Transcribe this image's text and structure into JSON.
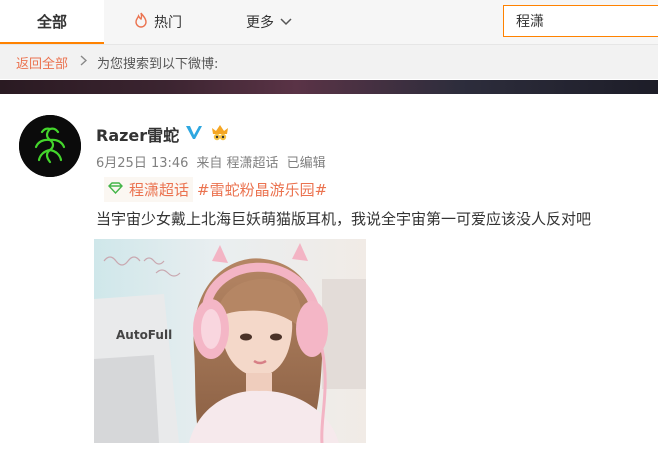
{
  "nav": {
    "tab_all": "全部",
    "tab_hot": "热门",
    "tab_more": "更多",
    "search_value": "程潇"
  },
  "breadcrumb": {
    "back_label": "返回全部",
    "hint": "为您搜索到以下微博:"
  },
  "post": {
    "author": "Razer雷蛇",
    "date": "6月25日 13:46",
    "source": "来自 程潇超话",
    "edited": "已编辑",
    "topic_super": "程潇超话",
    "topic_tag": "#雷蛇粉晶游乐园#",
    "text": "当宇宙少女戴上北海巨妖萌猫版耳机，我说全宇宙第一可爱应该没人反对吧",
    "photo_logo_text": "AutoFull"
  },
  "colors": {
    "accent": "#ff8200",
    "link": "#eb7350",
    "verified_blue": "#2ea7e0"
  }
}
